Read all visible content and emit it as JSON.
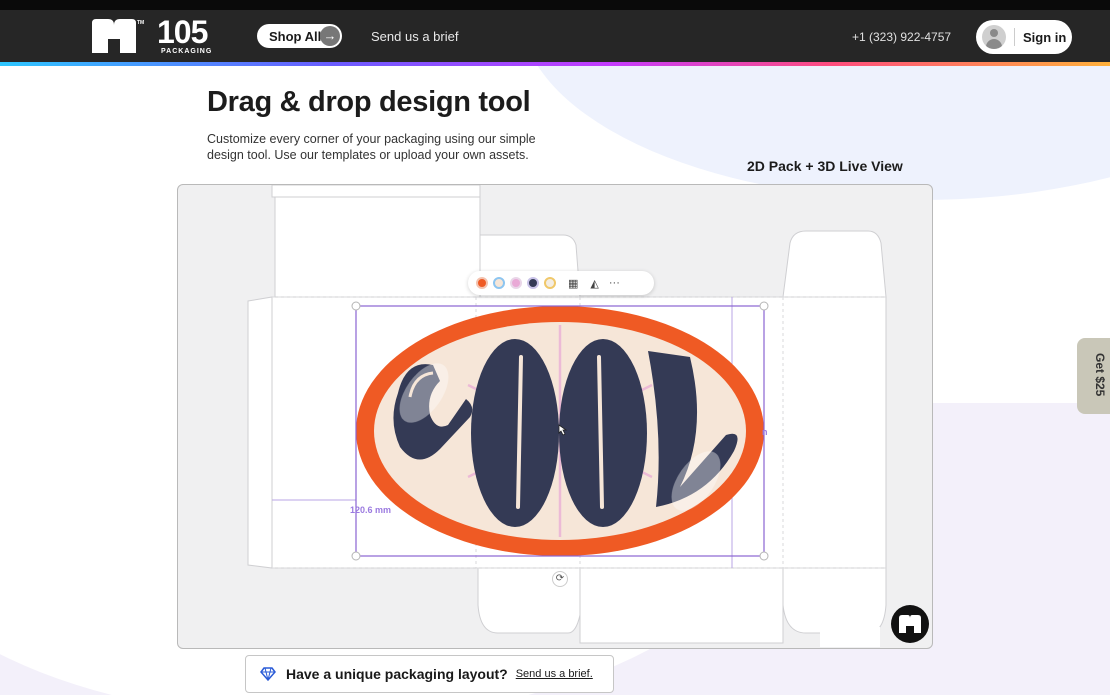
{
  "nav": {
    "logo": {
      "number": "105",
      "subtitle": "PACKAGING",
      "trademark": "TM"
    },
    "shop_all": "Shop All",
    "send_brief": "Send us a brief",
    "phone": "+1 (323) 922-4757",
    "sign_in": "Sign in"
  },
  "hero": {
    "title": "Drag & drop design tool",
    "description": "Customize every corner of your packaging using our simple design tool. Use our templates or upload your own assets.",
    "view_label": "2D Pack + 3D Live View"
  },
  "editor": {
    "toolbar": {
      "swatches": [
        "#ef5a24",
        "#f6e6d8",
        "#e9a9d6",
        "#343a55",
        "#f3ede4"
      ],
      "icons": [
        "texture-icon",
        "flip-icon",
        "more-icon"
      ],
      "more_glyph": "···"
    },
    "design_text": "COOL",
    "dimension_label": "120.6 mm",
    "dimension_label_partial": "n",
    "colors": {
      "outer_ring": "#ef5a24",
      "inner_fill": "#f6e6d8",
      "letters": "#343a55",
      "selection": "#8a63d2"
    }
  },
  "side_tab": {
    "label": "Get $25"
  },
  "callout": {
    "question": "Have a unique packaging layout?",
    "link": "Send us a brief."
  }
}
